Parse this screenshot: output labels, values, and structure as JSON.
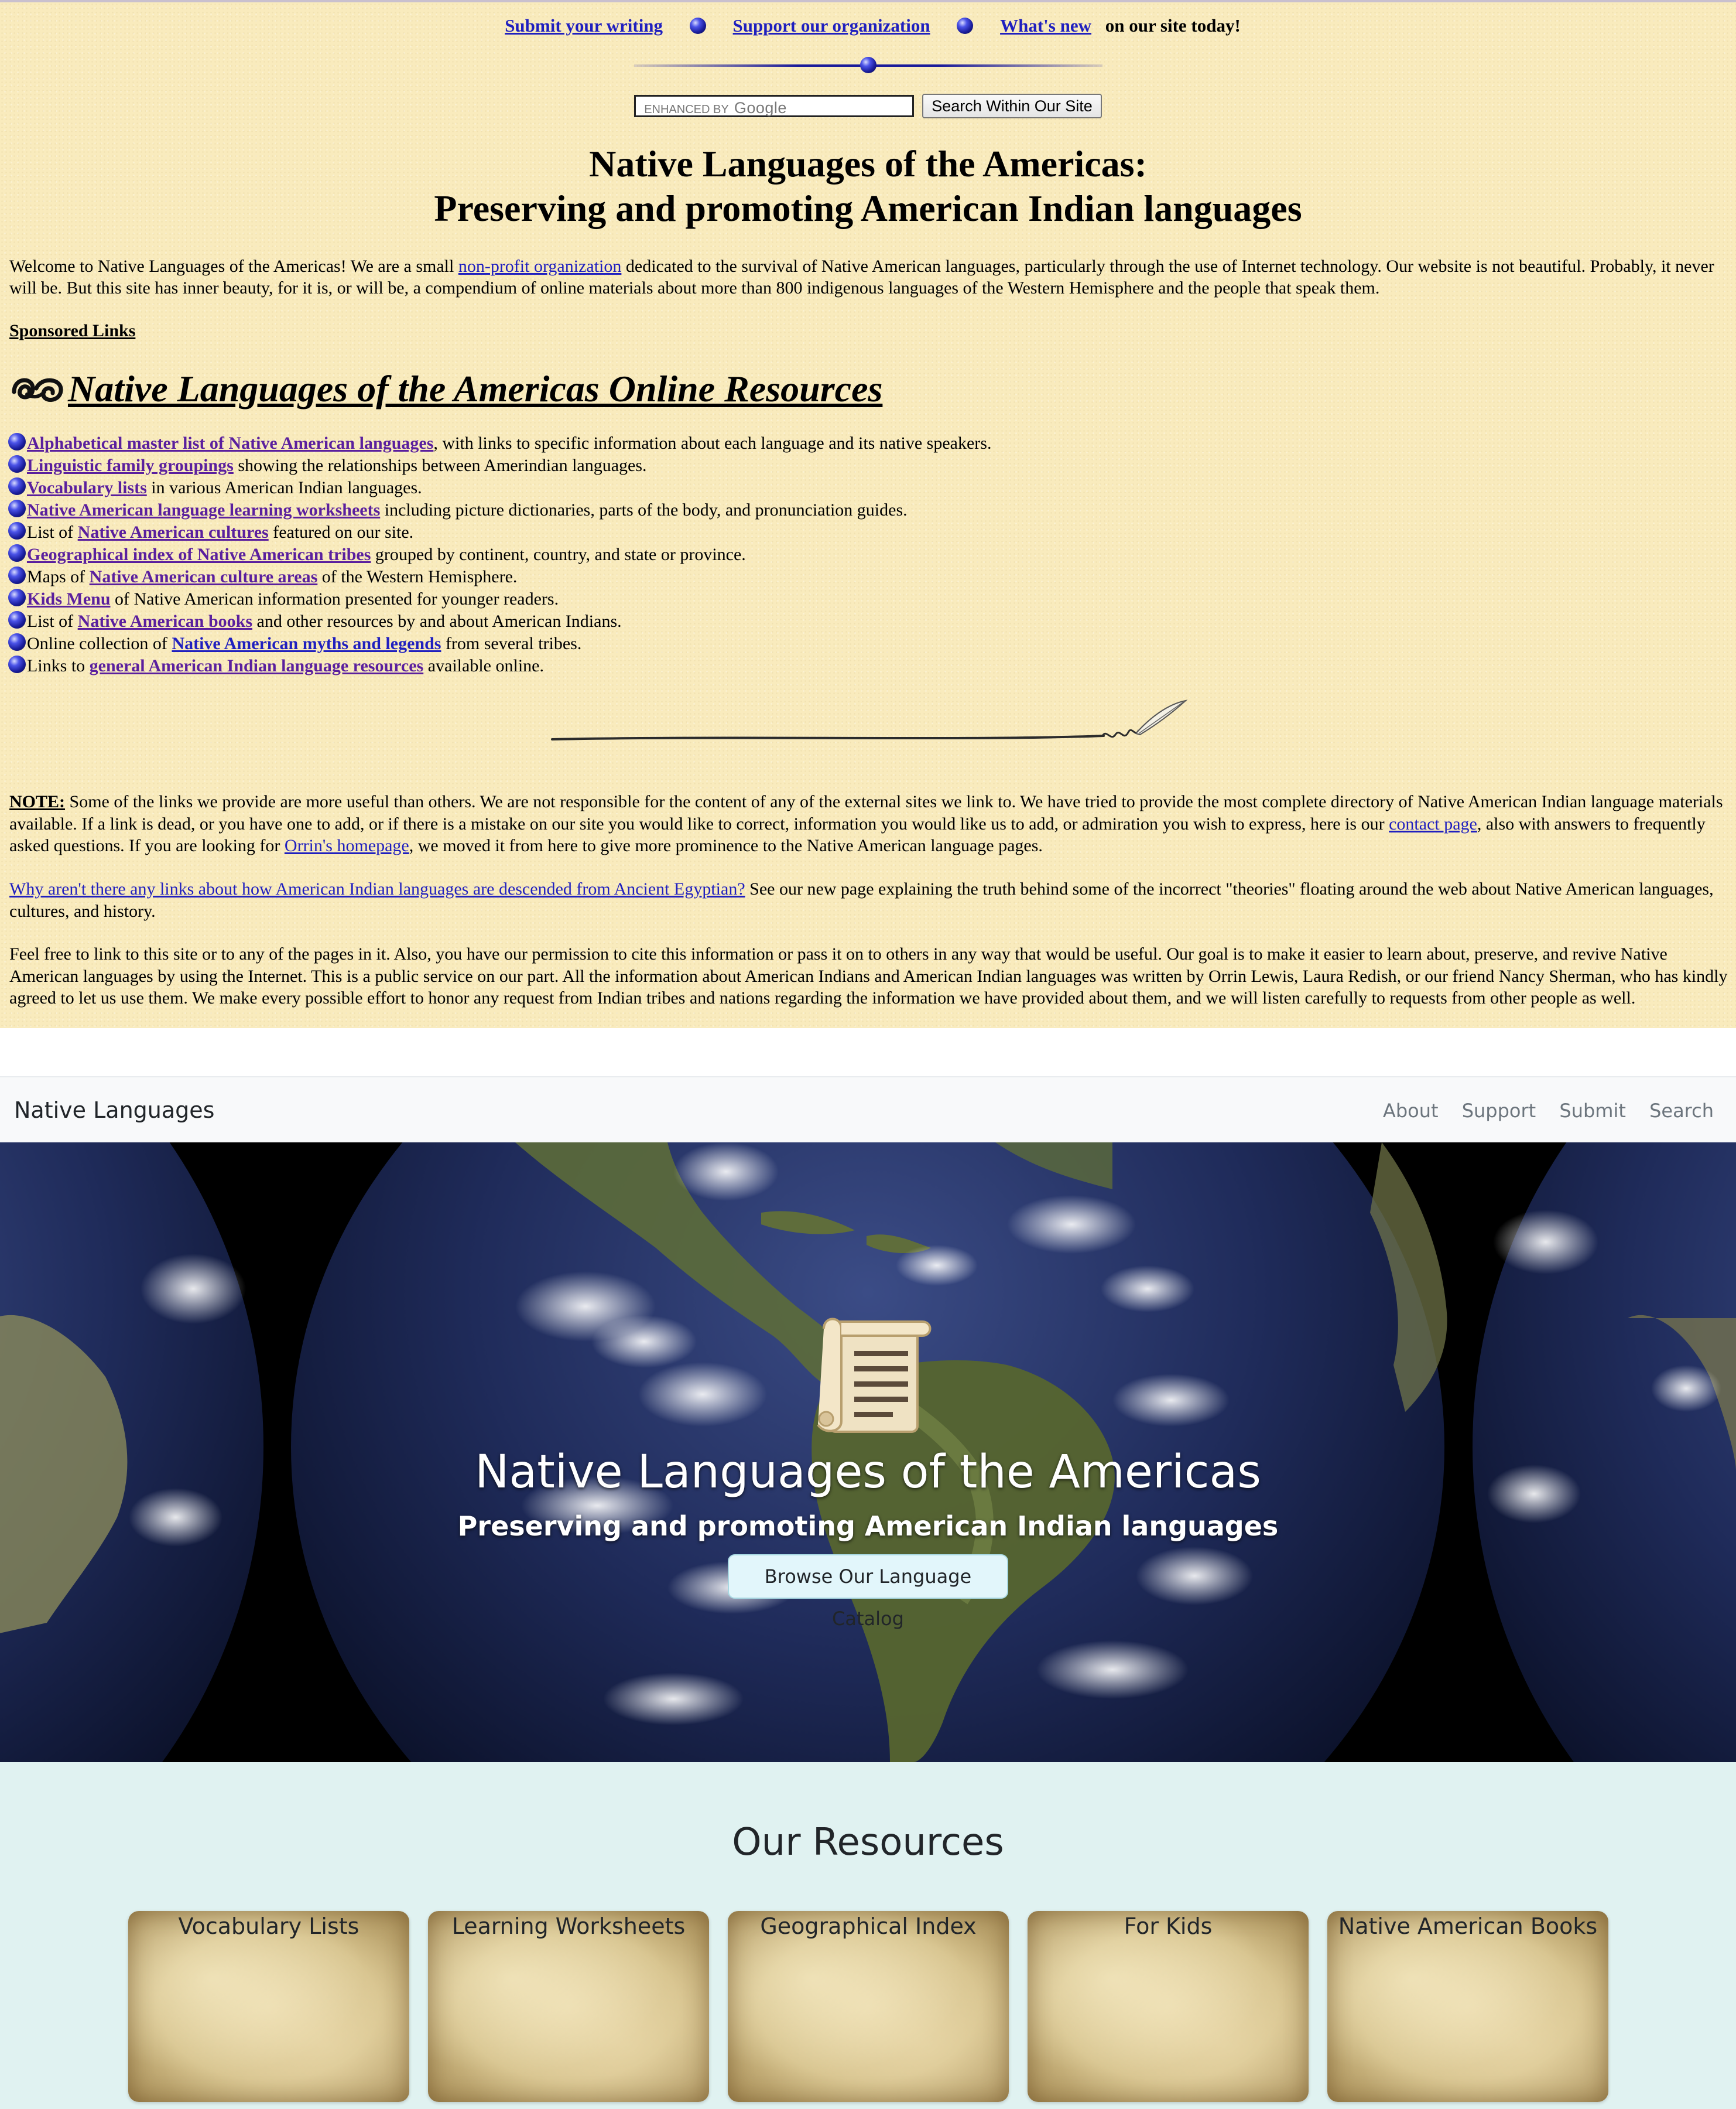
{
  "old_site": {
    "topnav": {
      "submit": "Submit your writing",
      "support": "Support our organization",
      "whatsnew": "What's new",
      "tail": "on our site today!"
    },
    "search": {
      "input_label": "ENHANCED BY",
      "input_brand": "Google",
      "button": "Search Within Our Site"
    },
    "title_line1": "Native Languages of the Americas:",
    "title_line2": "Preserving and promoting American Indian languages",
    "welcome": {
      "before": "Welcome to Native Languages of the Americas! We are a small ",
      "link": "non-profit organization",
      "after": " dedicated to the survival of Native American languages, particularly through the use of Internet technology. Our website is not beautiful. Probably, it never will be. But this site has inner beauty, for it is, or will be, a compendium of online materials about more than 800 indigenous languages of the Western Hemisphere and the people that speak them."
    },
    "sponsored": "Sponsored Links",
    "resources_heading": "Native Languages of the Americas Online Resources",
    "resources": [
      {
        "pre": "",
        "link": "Alphabetical master list of Native American languages",
        "post": ", with links to specific information about each language and its native speakers."
      },
      {
        "pre": "",
        "link": "Linguistic family groupings",
        "post": " showing the relationships between Amerindian languages."
      },
      {
        "pre": "",
        "link": "Vocabulary lists",
        "post": " in various American Indian languages."
      },
      {
        "pre": "",
        "link": "Native American language learning worksheets",
        "post": " including picture dictionaries, parts of the body, and pronunciation guides."
      },
      {
        "pre": "List of ",
        "link": "Native American cultures",
        "post": " featured on our site."
      },
      {
        "pre": "",
        "link": "Geographical index of Native American tribes",
        "post": " grouped by continent, country, and state or province."
      },
      {
        "pre": "Maps of ",
        "link": "Native American culture areas",
        "post": " of the Western Hemisphere."
      },
      {
        "pre": "",
        "link": "Kids Menu",
        "post": " of Native American information presented for younger readers."
      },
      {
        "pre": "List of ",
        "link": "Native American books",
        "post": " and other resources by and about American Indians."
      },
      {
        "pre": "Online collection of ",
        "link": "Native American myths and legends",
        "post": " from several tribes."
      },
      {
        "pre": "Links to ",
        "link": "general American Indian language resources",
        "post": " available online."
      }
    ],
    "note": {
      "label": "NOTE:",
      "text1": " Some of the links we provide are more useful than others. We are not responsible for the content of any of the external sites we link to. We have tried to provide the most complete directory of Native American Indian language materials available. If a link is dead, or you have one to add, or if there is a mistake on our site you would like to correct, information you would like us to add, or admiration you wish to express, here is our ",
      "contact_link": "contact page",
      "text2": ", also with answers to frequently asked questions. If you are looking for ",
      "orrin_link": "Orrin's homepage",
      "text3": ", we moved it from here to give more prominence to the Native American language pages."
    },
    "why": {
      "link": "Why aren't there any links about how American Indian languages are descended from Ancient Egyptian?",
      "text": " See our new page explaining the truth behind some of the incorrect \"theories\" floating around the web about Native American languages, cultures, and history."
    },
    "feel_free": "Feel free to link to this site or to any of the pages in it. Also, you have our permission to cite this information or pass it on to others in any way that would be useful. Our goal is to make it easier to learn about, preserve, and revive Native American languages by using the Internet. This is a public service on our part. All the information about American Indians and American Indian languages was written by Orrin Lewis, Laura Redish, or our friend Nancy Sherman, who has kindly agreed to let us use them. We make every possible effort to honor any request from Indian tribes and nations regarding the information we have provided about them, and we will listen carefully to requests from other people as well."
  },
  "new_site": {
    "brand": "Native Languages",
    "nav": [
      "About",
      "Support",
      "Submit",
      "Search"
    ],
    "hero_title": "Native Languages of the Americas",
    "hero_subtitle": "Preserving and promoting American Indian languages",
    "hero_button": "Browse Our Language Catalog",
    "resources_title": "Our Resources",
    "cards": [
      "Vocabulary Lists",
      "Learning Worksheets",
      "Geographical Index",
      "For Kids",
      "Native American Books"
    ]
  },
  "colors": {
    "old_background": "#f9ebbd",
    "link_blue": "#1f1fbf",
    "link_purple": "#5a1f9e",
    "navbar_bg": "#f8f9fa",
    "resources_bg": "#e0f2f1",
    "button_bg": "#e2f6fb"
  },
  "icons": {
    "bullet": "blue-sphere-bullet",
    "heading_ornament": "swirl-ornament-icon",
    "divider": "quill-divider",
    "hero": "scroll-icon"
  }
}
